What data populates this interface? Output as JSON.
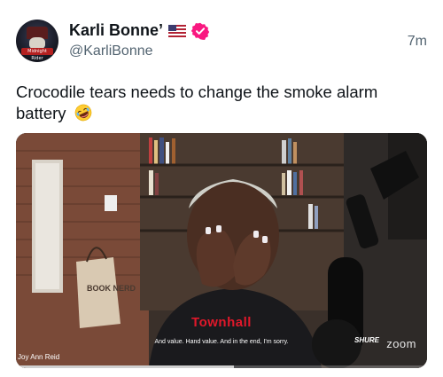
{
  "author": {
    "display_name": "Karli Bonne’",
    "handle": "@KarliBonne",
    "avatar_text": "Midnight Rider",
    "flag_icon": "us-flag-icon",
    "verified_icon": "verified-badge-icon",
    "verified_color": "#f91880"
  },
  "tweet": {
    "time": "7m",
    "text": "Crocodile tears needs to change the smoke alarm battery",
    "emoji_icon": "rolling-on-floor-laughing-emoji"
  },
  "media": {
    "watermark": "Townhall",
    "caption": "And value. Hand value. And in the end, I'm sorry.",
    "speaker_name": "Joy Ann Reid",
    "zoom_label": "zoom",
    "mic_brand": "SHURE",
    "sign_text": "BOOK NERD",
    "progress": 0.53
  }
}
